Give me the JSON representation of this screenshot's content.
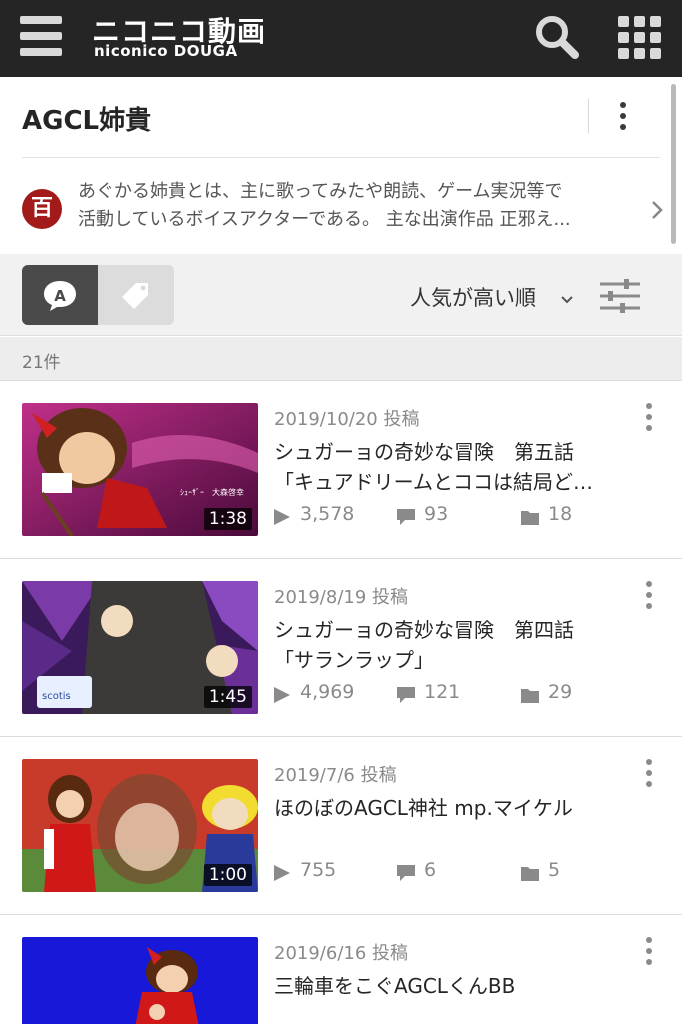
{
  "header": {
    "logo_jp": "ニコニコ動画",
    "logo_en": "niconico DOUGA"
  },
  "channel": {
    "name": "AGCL姉貴",
    "badge": "百",
    "description_line1": "あぐかる姉貴とは、主に歌ってみたや朗読、ゲーム実況等で",
    "description_line2": "活動しているボイスアクターである。 主な出演作品 正邪え..."
  },
  "toolbar": {
    "sort_label": "人気が高い順"
  },
  "results": {
    "count": "21件"
  },
  "colors": {
    "topbar": "#252525",
    "badge": "#a21a1a",
    "segment_active": "#4a4a4a"
  },
  "videos": [
    {
      "date": "2019/10/20 投稿",
      "title_line1": "シュガーョの奇妙な冒険　第五話",
      "title_line2": "「キュアドリームとココは結局ど…",
      "duration": "1:38",
      "views": "3,578",
      "comments": "93",
      "mylists": "18"
    },
    {
      "date": "2019/8/19 投稿",
      "title_line1": "シュガーョの奇妙な冒険　第四話",
      "title_line2": "「サランラップ」",
      "duration": "1:45",
      "views": "4,969",
      "comments": "121",
      "mylists": "29"
    },
    {
      "date": "2019/7/6 投稿",
      "title_line1": "ほのぼのAGCL神社 mp.マイケル",
      "title_line2": "",
      "duration": "1:00",
      "views": "755",
      "comments": "6",
      "mylists": "5"
    },
    {
      "date": "2019/6/16 投稿",
      "title_line1": "三輪車をこぐAGCLくんBB",
      "title_line2": "",
      "duration": "",
      "views": "",
      "comments": "",
      "mylists": ""
    }
  ]
}
